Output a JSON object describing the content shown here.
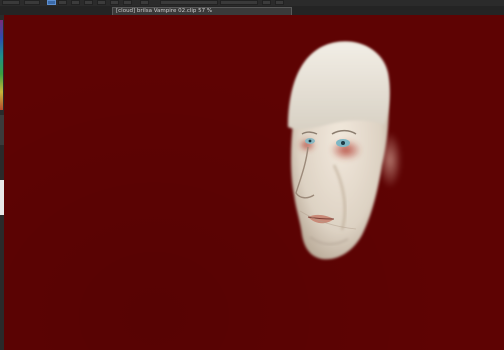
{
  "app": {
    "document_tab_title": "[cloud] brilsa Vampire 02.clip 57 %"
  },
  "toolbar": {
    "buttons": [
      {
        "name": "new-icon"
      },
      {
        "name": "open-icon"
      },
      {
        "name": "select-icon",
        "active": true
      },
      {
        "name": "transform-icon"
      },
      {
        "name": "layer-icon"
      },
      {
        "name": "clear-icon"
      },
      {
        "name": "rotate-icon"
      },
      {
        "name": "flip-icon"
      },
      {
        "name": "settings-icon"
      }
    ]
  },
  "canvas": {
    "background_color": "#5e0303",
    "subject": "painted vampire face"
  },
  "colors": {
    "ui_dark": "#1e1e1e",
    "tab_bg": "#3a3a3a",
    "active_button": "#3b6aa8",
    "canvas_red": "#5e0303"
  }
}
